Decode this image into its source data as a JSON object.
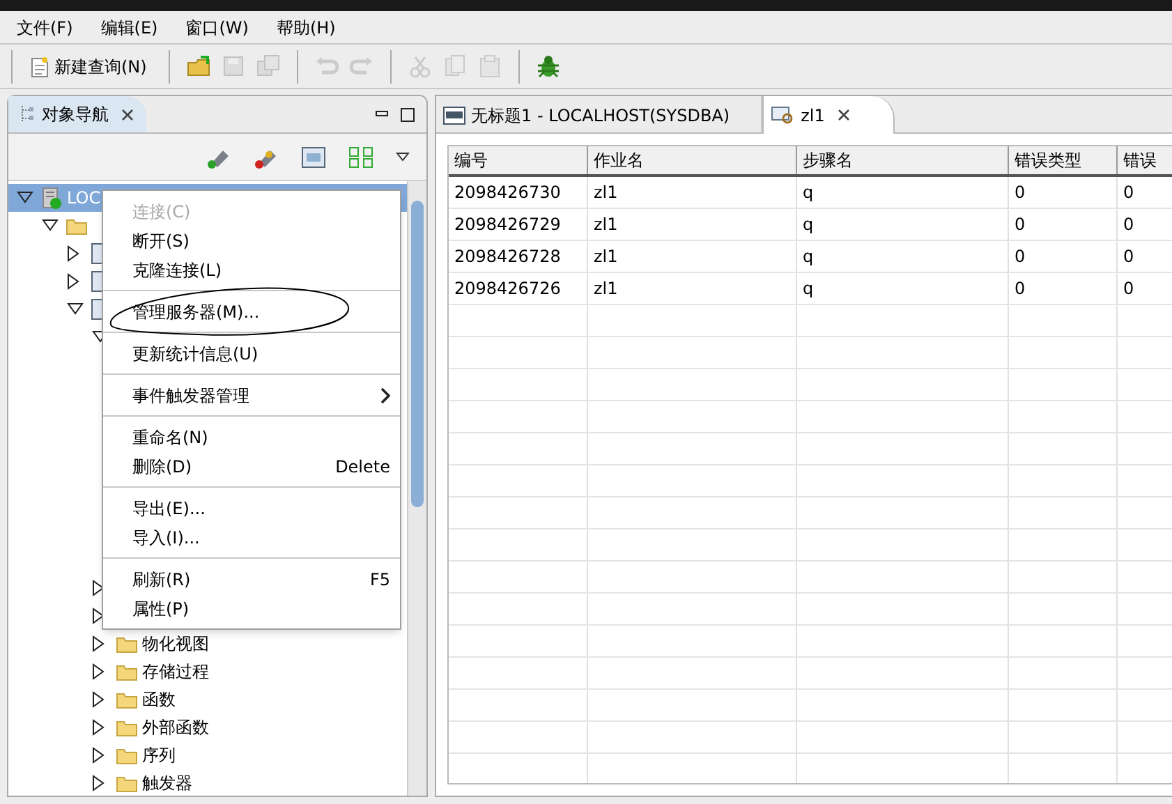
{
  "menu_bar": [
    {
      "label": "文件(F)"
    },
    {
      "label": "编辑(E)"
    },
    {
      "label": "窗口(W)"
    },
    {
      "label": "帮助(H)"
    }
  ],
  "toolbar": [
    {
      "kind": "button",
      "label": "新建查询(N)",
      "disabled": false
    },
    {
      "kind": "separator"
    },
    {
      "kind": "icon",
      "disabled": false
    },
    {
      "kind": "icon",
      "disabled": true
    },
    {
      "kind": "icon",
      "disabled": true
    },
    {
      "kind": "separator"
    },
    {
      "kind": "icon",
      "disabled": true
    },
    {
      "kind": "icon",
      "disabled": true
    },
    {
      "kind": "separator"
    },
    {
      "kind": "icon",
      "disabled": true
    },
    {
      "kind": "icon",
      "disabled": true
    },
    {
      "kind": "icon",
      "disabled": true
    },
    {
      "kind": "separator"
    },
    {
      "kind": "icon",
      "disabled": false
    }
  ],
  "navigator": {
    "tab": {
      "label": "对象导航",
      "selected": true
    },
    "tree": [
      {
        "label": "LOC",
        "kind": "server",
        "selected": true,
        "expanded": true,
        "children": [
          {
            "kind": "folder",
            "expanded": true,
            "children": [
              {
                "kind": "db",
                "expanded": false
              },
              {
                "kind": "db",
                "expanded": false
              },
              {
                "kind": "db",
                "expanded": true,
                "children": [
                  {
                    "kind": "hidden",
                    "expanded": true
                  },
                  {
                    "kind": "hidden",
                    "expanded": false
                  },
                  {
                    "kind": "hidden",
                    "expanded": false
                  },
                  {
                    "label": "物化视图",
                    "kind": "folder",
                    "expanded": false
                  },
                  {
                    "label": "存储过程",
                    "kind": "folder",
                    "expanded": false
                  },
                  {
                    "label": "函数",
                    "kind": "folder",
                    "expanded": false
                  },
                  {
                    "label": "外部函数",
                    "kind": "folder",
                    "expanded": false
                  },
                  {
                    "label": "序列",
                    "kind": "folder",
                    "expanded": false
                  },
                  {
                    "label": "触发器",
                    "kind": "folder",
                    "expanded": false
                  }
                ]
              }
            ]
          }
        ]
      }
    ]
  },
  "context_menu": [
    [
      {
        "label": "连接(C)",
        "disabled": true
      },
      {
        "label": "断开(S)",
        "disabled": false
      },
      {
        "label": "克隆连接(L)",
        "disabled": false
      }
    ],
    [
      {
        "label": "管理服务器(M)...",
        "disabled": false
      }
    ],
    [
      {
        "label": "更新统计信息(U)",
        "disabled": false
      }
    ],
    [
      {
        "label": "事件触发器管理",
        "disabled": false,
        "kind": "submenu"
      }
    ],
    [
      {
        "label": "重命名(N)",
        "disabled": false
      },
      {
        "label": "删除(D)",
        "shortcut": "Delete",
        "disabled": false
      }
    ],
    [
      {
        "label": "导出(E)...",
        "disabled": false
      },
      {
        "label": "导入(I)...",
        "disabled": false
      }
    ],
    [
      {
        "label": "刷新(R)",
        "shortcut": "F5",
        "disabled": false
      },
      {
        "label": "属性(P)",
        "disabled": false
      }
    ]
  ],
  "editor_tabs": [
    {
      "label": "无标题1 - LOCALHOST(SYSDBA)",
      "selected": false,
      "closable": false
    },
    {
      "label": "zl1",
      "selected": true,
      "closable": true
    }
  ],
  "table": {
    "columns": [
      "编号",
      "作业名",
      "步骤名",
      "错误类型",
      "错误"
    ],
    "rows": [
      [
        "2098426730",
        "zl1",
        "q",
        "0",
        "0"
      ],
      [
        "2098426729",
        "zl1",
        "q",
        "0",
        "0"
      ],
      [
        "2098426728",
        "zl1",
        "q",
        "0",
        "0"
      ],
      [
        "2098426726",
        "zl1",
        "q",
        "0",
        "0"
      ]
    ]
  }
}
